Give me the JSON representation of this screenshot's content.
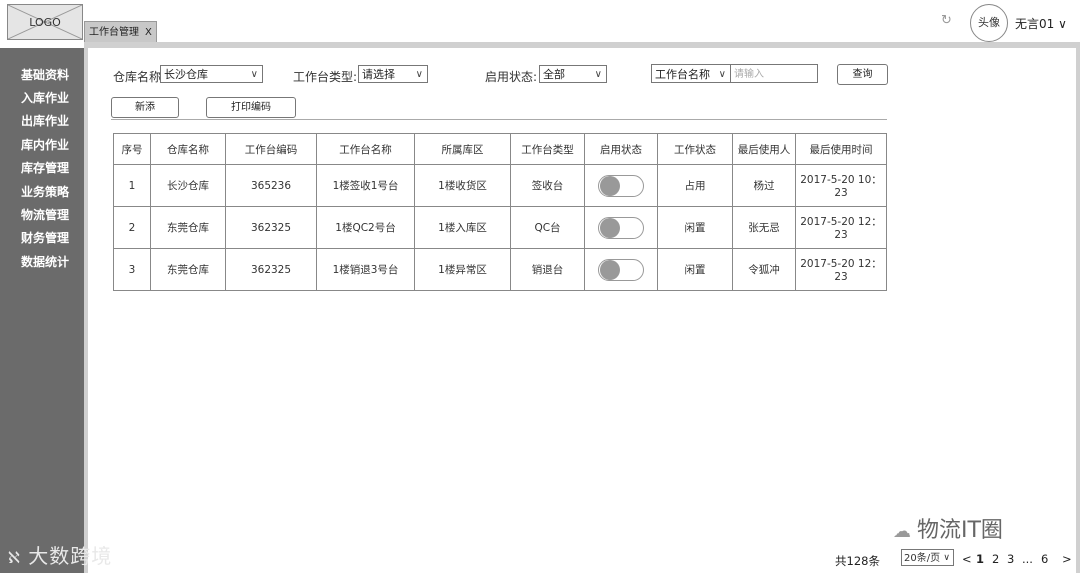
{
  "header": {
    "logo": "LOGO",
    "tab": {
      "label": "工作台管理",
      "close": "X"
    },
    "refresh_icon": "refresh-icon",
    "avatar": "头像",
    "username": "无言01 ∨"
  },
  "sidebar": {
    "items": [
      "基础资料",
      "入库作业",
      "出库作业",
      "库内作业",
      "库存管理",
      "业务策略",
      "物流管理",
      "财务管理",
      "数据统计"
    ]
  },
  "filters": {
    "warehouse_label": "仓库名称:",
    "warehouse_value": "长沙仓库",
    "type_label": "工作台类型:",
    "type_value": "请选择",
    "status_label": "启用状态:",
    "status_value": "全部",
    "name_select": "工作台名称",
    "name_placeholder": "请输入",
    "query": "查询",
    "add": "新添",
    "print": "打印编码"
  },
  "table": {
    "headers": [
      "序号",
      "仓库名称",
      "工作台编码",
      "工作台名称",
      "所属库区",
      "工作台类型",
      "启用状态",
      "工作状态",
      "最后使用人",
      "最后使用时间"
    ],
    "rows": [
      {
        "no": "1",
        "warehouse": "长沙仓库",
        "code": "365236",
        "name": "1楼签收1号台",
        "area": "1楼收货区",
        "type": "签收台",
        "work_status": "占用",
        "user": "杨过",
        "time": "2017-5-20 10：23"
      },
      {
        "no": "2",
        "warehouse": "东莞仓库",
        "code": "362325",
        "name": "1楼QC2号台",
        "area": "1楼入库区",
        "type": "QC台",
        "work_status": "闲置",
        "user": "张无忌",
        "time": "2017-5-20 12：23"
      },
      {
        "no": "3",
        "warehouse": "东莞仓库",
        "code": "362325",
        "name": "1楼销退3号台",
        "area": "1楼异常区",
        "type": "销退台",
        "work_status": "闲置",
        "user": "令狐冲",
        "time": "2017-5-20 12：23"
      }
    ]
  },
  "pagination": {
    "total": "共128条",
    "page_size": "20条/页",
    "prev": "<",
    "pages": [
      "1",
      "2",
      "3",
      "...",
      "6"
    ],
    "next": ">"
  },
  "watermarks": {
    "left": "大数跨境",
    "right": "物流IT圈"
  }
}
